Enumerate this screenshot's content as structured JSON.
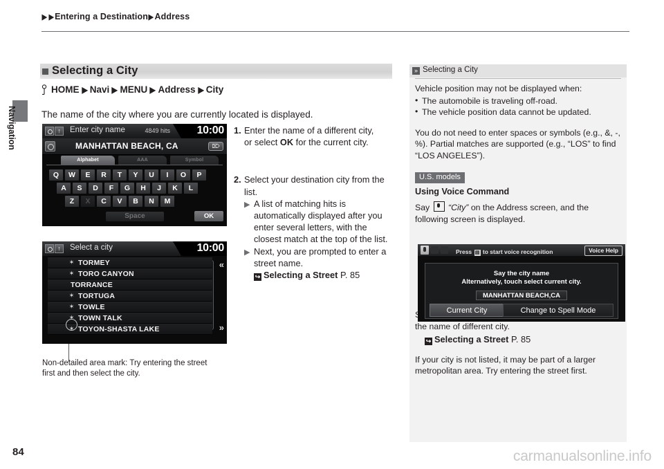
{
  "breadcrumb": {
    "item1": "Entering a Destination",
    "item2": "Address",
    "arrow": "▶"
  },
  "side_tab": {
    "label": "Navigation"
  },
  "section": {
    "heading": "Selecting a City",
    "path": [
      "HOME",
      "Navi",
      "MENU",
      "Address",
      "City"
    ],
    "path_arrow": "▶",
    "intro": "The name of the city where you are currently located is displayed."
  },
  "screen1": {
    "title": "Enter city name",
    "hits": "4849 hits",
    "clock": "10:00",
    "input_value": "MANHATTAN BEACH, CA",
    "delete_label": "⌦",
    "tabs": [
      {
        "label": "Alphabet",
        "state": "active"
      },
      {
        "label": "AAA",
        "state": "idle"
      },
      {
        "label": "Symbol",
        "state": "idle"
      }
    ],
    "keyrow1": [
      "Q",
      "W",
      "E",
      "R",
      "T",
      "Y",
      "U",
      "I",
      "O",
      "P"
    ],
    "keyrow2": [
      "A",
      "S",
      "D",
      "F",
      "G",
      "H",
      "J",
      "K",
      "L"
    ],
    "keyrow3": [
      "Z",
      "X",
      "C",
      "V",
      "B",
      "N",
      "M"
    ],
    "disabled_keys": [
      "X"
    ],
    "space_label": "Space",
    "ok_label": "OK"
  },
  "screen2": {
    "title": "Select a city",
    "clock": "10:00",
    "cities": [
      {
        "name": "TORMEY",
        "mark": true
      },
      {
        "name": "TORO CANYON",
        "mark": true
      },
      {
        "name": "TORRANCE",
        "mark": false
      },
      {
        "name": "TORTUGA",
        "mark": true
      },
      {
        "name": "TOWLE",
        "mark": true
      },
      {
        "name": "TOWN TALK",
        "mark": true
      },
      {
        "name": "TOYON-SHASTA LAKE",
        "mark": true
      }
    ],
    "mark_glyph": "✶",
    "scroll_up": "«",
    "scroll_down": "»"
  },
  "caption": "Non-detailed area mark: Try entering the street first and then select the city.",
  "steps": {
    "step1_num": "1.",
    "step1_a": "Enter the name of a different city,",
    "step1_b_pre": "or select ",
    "step1_b_bold": "OK",
    "step1_b_post": " for the current city.",
    "step2_num": "2.",
    "step2_text": "Select your destination city from the list.",
    "bullet_glyph": "▶",
    "step2_sub1": "A list of matching hits is automatically displayed after you enter several letters, with the closest match at the top of the list.",
    "step2_sub2": "Next, you are prompted to enter a street name.",
    "ref_icon": "↪",
    "ref_title": "Selecting a Street",
    "ref_page": "P. 85"
  },
  "right_panel": {
    "head_icon": "»",
    "head_title": "Selecting a City",
    "p1": "Vehicle position may not be displayed when:",
    "bullet1": "The automobile is traveling off-road.",
    "bullet2": "The vehicle position data cannot be updated.",
    "p2": "You do not need to enter spaces or symbols (e.g., &, -, %). Partial matches are supported (e.g., “LOS” to find “LOS ANGELES”).",
    "badge": "U.S. models",
    "subhead": "Using Voice Command",
    "say_pre": "Say ",
    "say_city": "“City”",
    "say_post": " on the Address screen, and the following screen is displayed.",
    "after_pre": "Select ",
    "after_bold": "Current City",
    "after_post": " for your current location, or say the name of different city.",
    "ref_icon": "↪",
    "ref_title": "Selecting a Street",
    "ref_page": "P. 85",
    "p_last": "If your city is not listed, it may be part of a larger metropolitan area. Try entering the street first."
  },
  "voice_screen": {
    "press_pre": "Press ",
    "press_key": "⌸",
    "press_post": " to start voice recognition",
    "voice_help": "Voice Help",
    "line1": "Say the city name",
    "line2": "Alternatively, touch select current city.",
    "city_value": "MANHATTAN BEACH,CA",
    "btn_left": "Current City",
    "btn_right": "Change to Spell Mode"
  },
  "footer": {
    "page_number": "84",
    "watermark": "carmanualsonline.info"
  }
}
